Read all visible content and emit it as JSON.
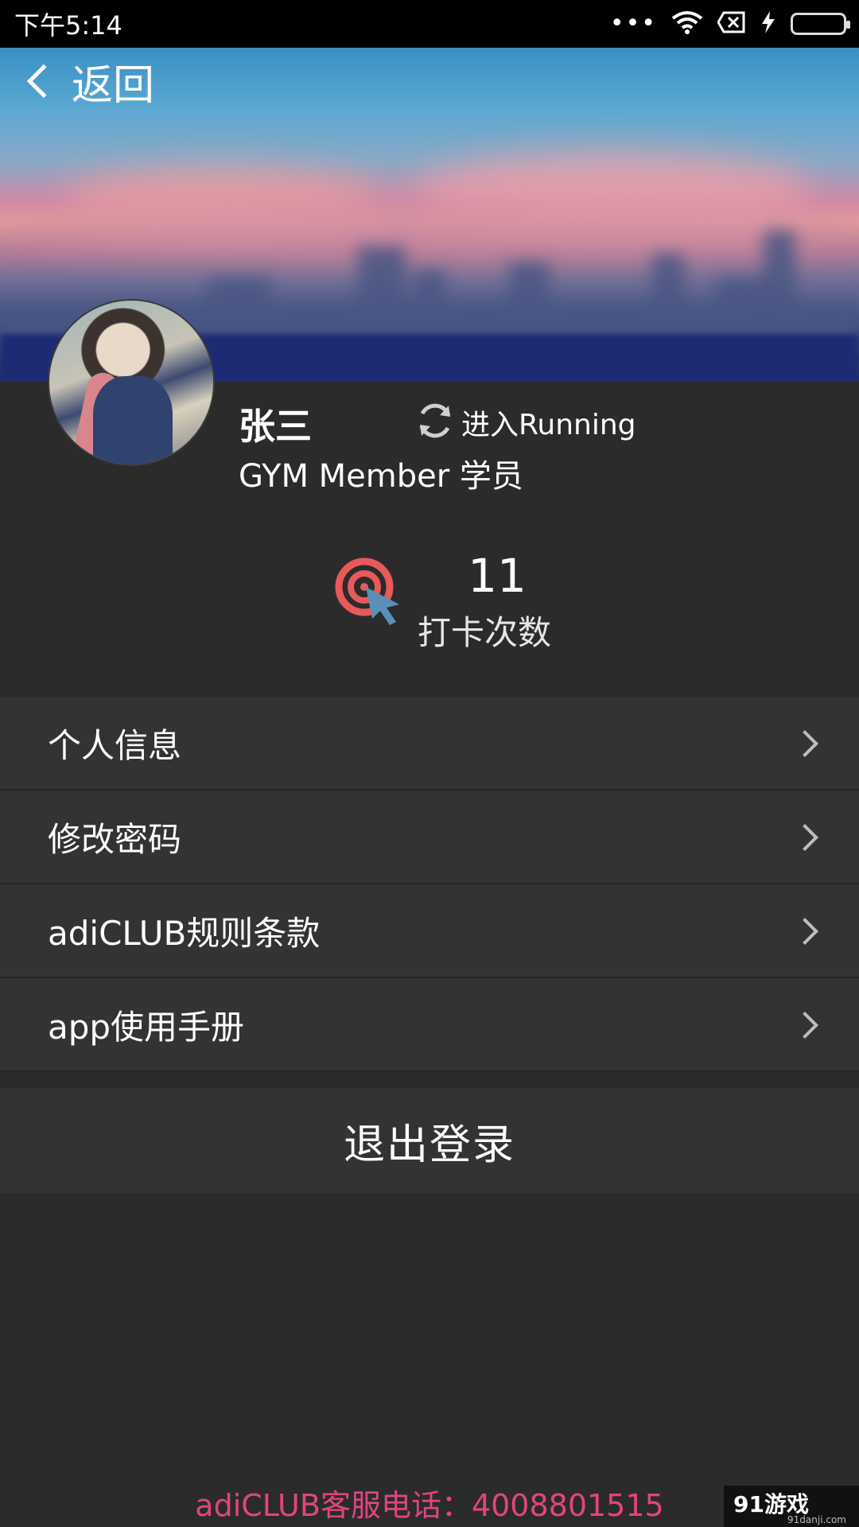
{
  "status_bar": {
    "time": "下午5:14",
    "dots": "•••",
    "wifi_icon": "wifi-icon",
    "close_icon": "close-box-icon",
    "charge_icon": "lightning-icon",
    "battery_level": 1.0
  },
  "header": {
    "back_label": "返回"
  },
  "profile": {
    "name": "张三",
    "switch_label": "进入Running",
    "role": "GYM Member 学员"
  },
  "stats": {
    "count": "11",
    "label": "打卡次数"
  },
  "menu": {
    "items": [
      {
        "label": "个人信息"
      },
      {
        "label": "修改密码"
      },
      {
        "label": "adiCLUB规则条款"
      },
      {
        "label": "app使用手册"
      }
    ]
  },
  "logout_label": "退出登录",
  "footer": {
    "service": "adiCLUB客服电话：4008801515"
  },
  "watermark": {
    "logo": "91游戏",
    "site": "91danji.com"
  },
  "colors": {
    "background": "#2b2b2b",
    "row": "#333333",
    "accent_pink": "#e0457f",
    "target_red": "#e85a5a",
    "cursor_blue": "#5a8fb8"
  }
}
